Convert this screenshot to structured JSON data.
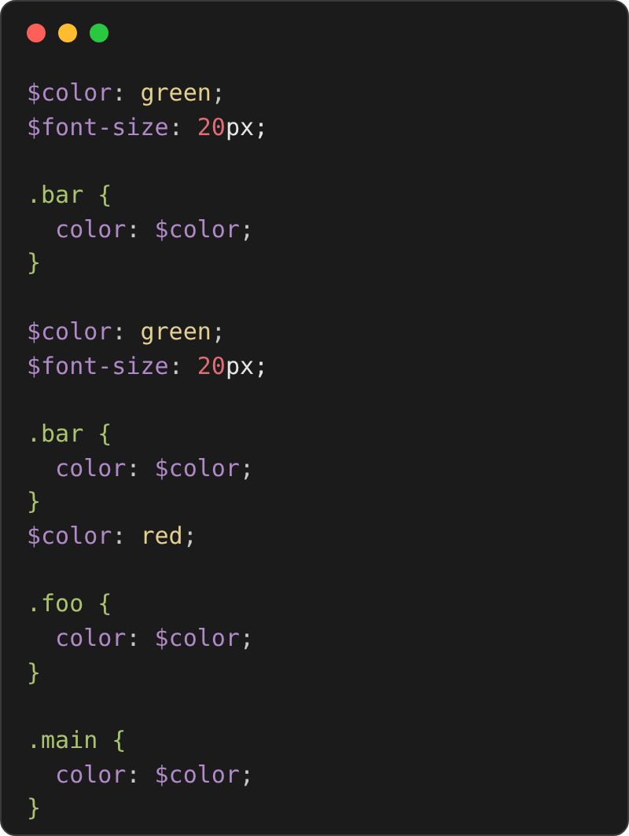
{
  "window": {
    "controls": [
      {
        "kind": "close"
      },
      {
        "kind": "minimize"
      },
      {
        "kind": "zoom"
      }
    ]
  },
  "code_lines": [
    {
      "kind": "code",
      "tokens": [
        {
          "text": "$color",
          "kind": "variable"
        },
        {
          "text": ": ",
          "kind": "punct"
        },
        {
          "text": "green",
          "kind": "value"
        },
        {
          "text": ";",
          "kind": "punct"
        }
      ]
    },
    {
      "kind": "code",
      "tokens": [
        {
          "text": "$font-size",
          "kind": "variable"
        },
        {
          "text": ": ",
          "kind": "punct"
        },
        {
          "text": "20",
          "kind": "number"
        },
        {
          "text": "px;",
          "kind": "plain"
        }
      ]
    },
    {
      "kind": "blank"
    },
    {
      "kind": "code",
      "tokens": [
        {
          "text": ".bar {",
          "kind": "selector"
        }
      ]
    },
    {
      "kind": "code",
      "tokens": [
        {
          "text": "  color",
          "kind": "property"
        },
        {
          "text": ": ",
          "kind": "punct"
        },
        {
          "text": "$color",
          "kind": "variable"
        },
        {
          "text": ";",
          "kind": "punct"
        }
      ]
    },
    {
      "kind": "code",
      "tokens": [
        {
          "text": "}",
          "kind": "selector"
        }
      ]
    },
    {
      "kind": "blank"
    },
    {
      "kind": "code",
      "tokens": [
        {
          "text": "$color",
          "kind": "variable"
        },
        {
          "text": ": ",
          "kind": "punct"
        },
        {
          "text": "green",
          "kind": "value"
        },
        {
          "text": ";",
          "kind": "punct"
        }
      ]
    },
    {
      "kind": "code",
      "tokens": [
        {
          "text": "$font-size",
          "kind": "variable"
        },
        {
          "text": ": ",
          "kind": "punct"
        },
        {
          "text": "20",
          "kind": "number"
        },
        {
          "text": "px;",
          "kind": "plain"
        }
      ]
    },
    {
      "kind": "blank"
    },
    {
      "kind": "code",
      "tokens": [
        {
          "text": ".bar {",
          "kind": "selector"
        }
      ]
    },
    {
      "kind": "code",
      "tokens": [
        {
          "text": "  color",
          "kind": "property"
        },
        {
          "text": ": ",
          "kind": "punct"
        },
        {
          "text": "$color",
          "kind": "variable"
        },
        {
          "text": ";",
          "kind": "punct"
        }
      ]
    },
    {
      "kind": "code",
      "tokens": [
        {
          "text": "}",
          "kind": "selector"
        }
      ]
    },
    {
      "kind": "code",
      "tokens": [
        {
          "text": "$color",
          "kind": "variable"
        },
        {
          "text": ": ",
          "kind": "punct"
        },
        {
          "text": "red",
          "kind": "value"
        },
        {
          "text": ";",
          "kind": "punct"
        }
      ]
    },
    {
      "kind": "blank"
    },
    {
      "kind": "code",
      "tokens": [
        {
          "text": ".foo {",
          "kind": "selector"
        }
      ]
    },
    {
      "kind": "code",
      "tokens": [
        {
          "text": "  color",
          "kind": "property"
        },
        {
          "text": ": ",
          "kind": "punct"
        },
        {
          "text": "$color",
          "kind": "variable"
        },
        {
          "text": ";",
          "kind": "punct"
        }
      ]
    },
    {
      "kind": "code",
      "tokens": [
        {
          "text": "}",
          "kind": "selector"
        }
      ]
    },
    {
      "kind": "blank"
    },
    {
      "kind": "code",
      "tokens": [
        {
          "text": ".main {",
          "kind": "selector"
        }
      ]
    },
    {
      "kind": "code",
      "tokens": [
        {
          "text": "  color",
          "kind": "property"
        },
        {
          "text": ": ",
          "kind": "punct"
        },
        {
          "text": "$color",
          "kind": "variable"
        },
        {
          "text": ";",
          "kind": "punct"
        }
      ]
    },
    {
      "kind": "code",
      "tokens": [
        {
          "text": "}",
          "kind": "selector"
        }
      ]
    }
  ]
}
